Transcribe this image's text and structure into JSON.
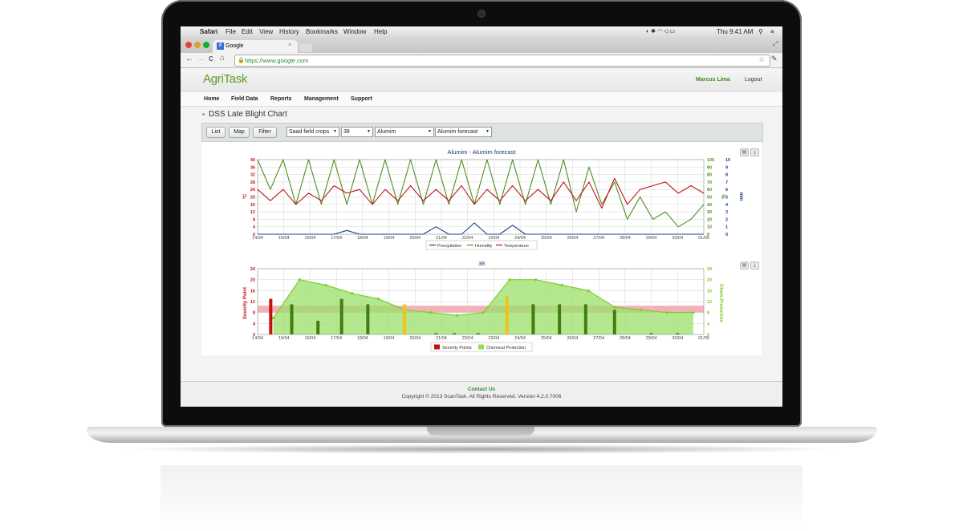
{
  "colors": {
    "brand_green": "#5a9a1e",
    "temp_red": "#c0121e",
    "humidity_green": "#4e8f1e",
    "precip_blue": "#1c3f8a",
    "protection_fill": "#9be06a",
    "severity_red": "#c81010",
    "severity_yellow": "#f2c21a",
    "threshold_pink": "#f4b0b8"
  },
  "mac_menu": {
    "apple": "",
    "app": "Safari",
    "items": [
      "File",
      "Edit",
      "View",
      "History",
      "Bookmarks",
      "Window",
      "Help"
    ],
    "clock": "Thu 9:41 AM"
  },
  "browser": {
    "tab_title": "Google",
    "tab_favicon": "8",
    "url": "https://www.google.com",
    "back_icon": "←",
    "forward_icon": "→",
    "reload_icon": "C",
    "home_icon": "⌂",
    "star_icon": "☆",
    "wrench_icon": "✎"
  },
  "app": {
    "logo": "AgriTask",
    "user": "Marcus Lima",
    "logout": "Logout",
    "nav": [
      "Home",
      "Field Data",
      "Reports",
      "Management",
      "Support"
    ],
    "page_title": "DSS Late Blight Chart",
    "buttons": [
      "List",
      "Map",
      "Filter"
    ],
    "selects": [
      "Saad field crops",
      "38",
      "Alumim",
      "Alumim forecast"
    ]
  },
  "footer": {
    "contact": "Contact Us",
    "copyright": "Copyright © 2013 ScanTask. All Rights Reserved. Version 4.2.0.7006"
  },
  "chart_data": [
    {
      "type": "line",
      "title": "Alumim - Alumim forecast",
      "x_ticks": [
        "14/04",
        "15/04",
        "16/04",
        "17/04",
        "18/04",
        "19/04",
        "20/04",
        "21/04",
        "22/04",
        "23/04",
        "24/04",
        "25/04",
        "26/04",
        "27/04",
        "28/04",
        "29/04",
        "30/04",
        "01/05"
      ],
      "y_left": {
        "label": "°C",
        "ticks": [
          0,
          4,
          8,
          12,
          16,
          20,
          24,
          28,
          32,
          36,
          40
        ]
      },
      "y_right": {
        "label": "%",
        "ticks": [
          0,
          10,
          20,
          30,
          40,
          50,
          60,
          70,
          80,
          90,
          100
        ]
      },
      "y_right2": {
        "label": "mm",
        "ticks": [
          0,
          1,
          2,
          3,
          4,
          5,
          6,
          7,
          8,
          9,
          10
        ]
      },
      "legend": [
        "Precipitation",
        "Humidity",
        "Temperature"
      ],
      "grid": true,
      "series": [
        {
          "name": "Temperature",
          "axis": "°C",
          "values": [
            24,
            18,
            24,
            16,
            22,
            18,
            26,
            22,
            24,
            16,
            24,
            18,
            26,
            18,
            24,
            18,
            26,
            16,
            24,
            18,
            26,
            18,
            24,
            18,
            28,
            18,
            28,
            14,
            30,
            16,
            24,
            26,
            28,
            22,
            26,
            22
          ]
        },
        {
          "name": "Humidity",
          "axis": "%",
          "values": [
            100,
            60,
            100,
            40,
            100,
            40,
            100,
            40,
            100,
            40,
            100,
            40,
            100,
            40,
            100,
            40,
            100,
            40,
            100,
            40,
            100,
            40,
            100,
            40,
            100,
            30,
            90,
            40,
            70,
            20,
            50,
            20,
            30,
            10,
            20,
            40
          ]
        },
        {
          "name": "Precipitation",
          "axis": "mm",
          "values": [
            0,
            0,
            0,
            0,
            0,
            0,
            0,
            0.5,
            0,
            0,
            0,
            0,
            0,
            0,
            1,
            0,
            0,
            1.5,
            0,
            0,
            1.2,
            0,
            0,
            0,
            0,
            0,
            0,
            0,
            0,
            0,
            0,
            0,
            0,
            0,
            0,
            0
          ]
        }
      ]
    },
    {
      "type": "bar",
      "title": "38",
      "x_ticks": [
        "14/04",
        "15/04",
        "16/04",
        "17/04",
        "18/04",
        "19/04",
        "20/04",
        "21/04",
        "22/04",
        "23/04",
        "24/04",
        "25/04",
        "26/04",
        "27/04",
        "28/04",
        "29/04",
        "30/04",
        "01/05"
      ],
      "y_left": {
        "label": "Severity Point",
        "ticks": [
          0,
          4,
          8,
          12,
          16,
          20,
          24
        ]
      },
      "y_right": {
        "label": "Chem.Protection",
        "ticks": [
          0,
          4,
          8,
          12,
          16,
          20,
          24
        ]
      },
      "legend": [
        "Severity Points",
        "Chemical Protection"
      ],
      "threshold_band": [
        8,
        10.5
      ],
      "protection_x": [
        0.6,
        1.6,
        2.6,
        3.6,
        4.6,
        5.6,
        6.6,
        7.6,
        8.6,
        9.6,
        10.6,
        11.6,
        12.6,
        13.6,
        14.6,
        15.6,
        16.6
      ],
      "protection": [
        6,
        20,
        18,
        15,
        13,
        9,
        8,
        7,
        8,
        20,
        20,
        18,
        16,
        10,
        9,
        8,
        8
      ],
      "severity_x": [
        0.5,
        1.3,
        2.3,
        3.2,
        4.2,
        5.6,
        6.8,
        7.5,
        8.4,
        9.5,
        10.5,
        11.5,
        12.5,
        13.6,
        15.0,
        16.0
      ],
      "severity": [
        13,
        11,
        5,
        13,
        11,
        11,
        0.5,
        0.5,
        0.5,
        14,
        11,
        11,
        11,
        9,
        0.5,
        0.5
      ],
      "severity_colors": [
        "red",
        "green",
        "green",
        "green",
        "green",
        "yellow",
        "green",
        "green",
        "green",
        "yellow",
        "green",
        "green",
        "green",
        "green",
        "green",
        "green"
      ]
    }
  ]
}
